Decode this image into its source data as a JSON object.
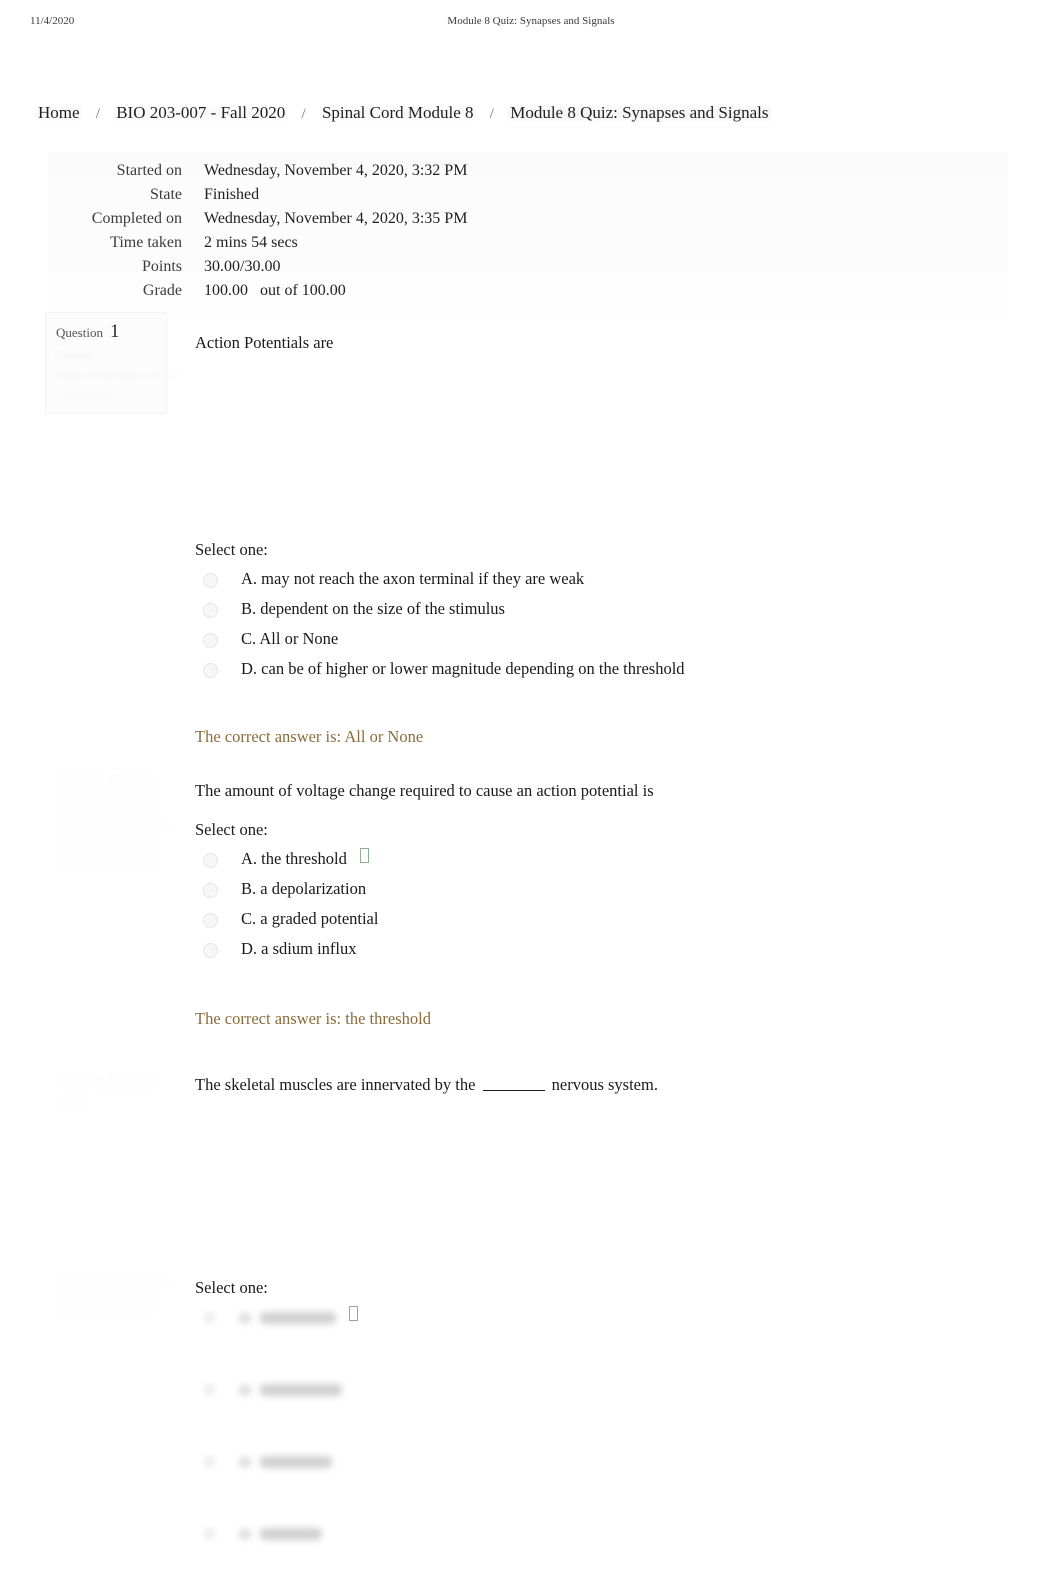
{
  "print_header": {
    "date": "11/4/2020",
    "title": "Module 8 Quiz: Synapses and Signals"
  },
  "breadcrumb": {
    "separator": "/",
    "items": [
      {
        "label": "Home"
      },
      {
        "label": "BIO 203-007 - Fall 2020"
      },
      {
        "label": "Spinal Cord Module 8"
      },
      {
        "label": "Module 8 Quiz: Synapses and Signals"
      }
    ]
  },
  "summary": {
    "rows": [
      {
        "label": "Started on",
        "value": "Wednesday, November 4, 2020, 3:32 PM"
      },
      {
        "label": "State",
        "value": "Finished"
      },
      {
        "label": "Completed on",
        "value": "Wednesday, November 4, 2020, 3:35 PM"
      },
      {
        "label": "Time taken",
        "value": "2 mins 54 secs"
      },
      {
        "label": "Points",
        "value": "30.00/30.00"
      }
    ],
    "grade": {
      "label": "Grade",
      "value": "100.00",
      "out_of": "out of 100.00"
    }
  },
  "questions": [
    {
      "info": {
        "number_label": "Question",
        "number": "1",
        "state": "Correct",
        "marks": "Points 10.00 out of 10.00",
        "flag": "Flag question"
      },
      "text": "Action Potentials are",
      "select_label": "Select one:",
      "answers": [
        {
          "letter": "A.",
          "label": "may not reach the axon terminal if they are weak",
          "selected": false,
          "ticked": false
        },
        {
          "letter": "B.",
          "label": "dependent on the size of the stimulus",
          "selected": false,
          "ticked": false
        },
        {
          "letter": "C.",
          "label": "All or None",
          "selected": false,
          "ticked": false
        },
        {
          "letter": "D.",
          "label": "can be of higher or lower magnitude depending on the threshold",
          "selected": false,
          "ticked": false
        }
      ],
      "correct_answer": "The correct answer is: All or None"
    },
    {
      "info": {
        "number_label": "Question",
        "number": "2",
        "state": "Correct",
        "marks": "Points 10.00 out of 10.00",
        "flag": "Flag question"
      },
      "text": "The amount of voltage change required to cause an action potential is",
      "select_label": "Select one:",
      "answers": [
        {
          "letter": "A.",
          "label": "the threshold",
          "selected": true,
          "ticked": true
        },
        {
          "letter": "B.",
          "label": "a depolarization",
          "selected": false,
          "ticked": false
        },
        {
          "letter": "C.",
          "label": "a graded potential",
          "selected": false,
          "ticked": false
        },
        {
          "letter": "D.",
          "label": "a sdium influx",
          "selected": false,
          "ticked": false
        }
      ],
      "correct_answer": "The correct answer is: the threshold"
    },
    {
      "info": {
        "number_label": "Question",
        "number": "3",
        "state": "Correct",
        "marks": "Points 10.00 out of 10.00",
        "flag": "Flag question"
      },
      "text_parts": {
        "before": "The skeletal muscles are innervated by the",
        "blank": "________",
        "after": "nervous system."
      },
      "select_label": "Select one:",
      "answers": [
        {
          "letter": "",
          "label": "",
          "illegible": true,
          "ticked": true,
          "smudge_width": 76
        },
        {
          "letter": "",
          "label": "",
          "illegible": true,
          "ticked": false,
          "smudge_width": 82
        },
        {
          "letter": "",
          "label": "",
          "illegible": true,
          "ticked": false,
          "smudge_width": 72
        },
        {
          "letter": "",
          "label": "",
          "illegible": true,
          "ticked": false,
          "smudge_width": 62
        }
      ]
    }
  ]
}
